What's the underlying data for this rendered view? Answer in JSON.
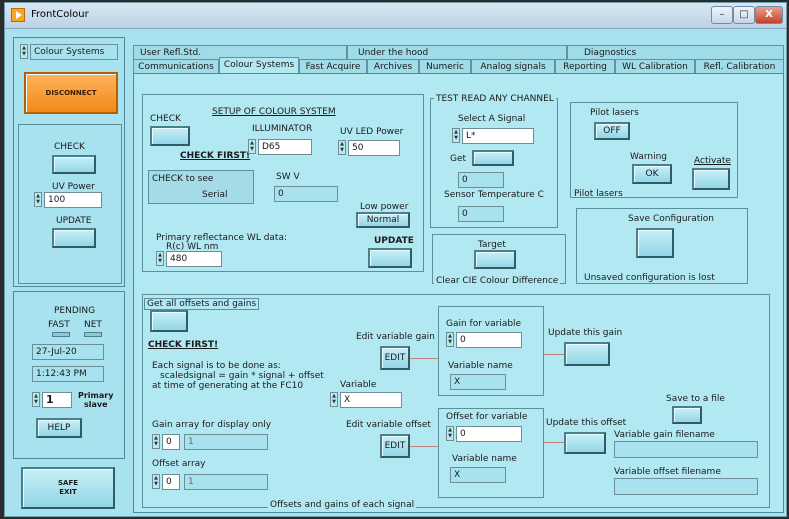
{
  "window": {
    "title": "FrontColour",
    "min": "–",
    "max": "□",
    "close": "X"
  },
  "left": {
    "nav_label": "Colour Systems",
    "disconnect": "DISCONNECT",
    "check": "CHECK",
    "uv_power_label": "UV Power",
    "uv_power_value": "100",
    "update": "UPDATE",
    "pending": "PENDING",
    "fast": "FAST",
    "net": "NET",
    "date": "27-Jul-20",
    "time": "1:12:43 PM",
    "slave_value": "1",
    "primary": "Primary",
    "slave": "slave",
    "help": "HELP",
    "safe_exit": "SAFE\nEXIT"
  },
  "tabs_row1": [
    "User Refl.Std.",
    "Under the hood",
    "Diagnostics"
  ],
  "tabs_row2": [
    "Communications",
    "Colour Systems",
    "Fast Acquire",
    "Archives",
    "Numeric",
    "Analog signals",
    "Reporting",
    "WL Calibration",
    "Refl. Calibration"
  ],
  "setup": {
    "check": "CHECK",
    "title": "SETUP OF COLOUR SYSTEM",
    "check_first": "CHECK FIRST!",
    "illuminator": "ILLUMINATOR",
    "illuminator_value": "D65",
    "uv_led_power": "UV LED Power",
    "uv_led_value": "50",
    "check_to_see": "CHECK to see",
    "serial": "Serial",
    "sw_v": "SW V",
    "sw_v_value": "0",
    "low_power": "Low power",
    "normal": "Normal",
    "primary_wl": "Primary reflectance WL data:",
    "rwl": "R(c) WL nm",
    "wl_value": "480",
    "update": "UPDATE"
  },
  "test": {
    "title": "TEST READ ANY CHANNEL",
    "select": "Select A Signal",
    "select_value": "L*",
    "get": "Get",
    "get_value": "0",
    "sensor_temp": "Sensor Temperature C",
    "temp_value": "0"
  },
  "target": {
    "label": "Target",
    "caption": "Clear CIE Colour Difference"
  },
  "pilot": {
    "title": "Pilot lasers",
    "off": "OFF",
    "warning": "Warning",
    "ok": "OK",
    "activate": "Activate",
    "footer": "Pilot lasers"
  },
  "save_config": {
    "title": "Save Configuration",
    "note": "Unsaved  configuration is lost"
  },
  "offsets": {
    "get_all": "Get all offsets and gains",
    "check_first": "CHECK FIRST!",
    "note1": "Each signal is to be done as:",
    "note2": "scaledsignal = gain * signal  + offset",
    "note3": "at time of  generating at the FC10",
    "variable": "Variable",
    "variable_value": "X",
    "gain_array": "Gain array for display only",
    "gain_idx": "0",
    "gain_val": "1",
    "offset_array": "Offset array",
    "offset_idx": "0",
    "offset_val": "1",
    "edit_gain": "Edit variable gain",
    "edit": "EDIT",
    "gain_for_var": "Gain for variable",
    "gain_value": "0",
    "var_name": "Variable name",
    "var_name_value": "X",
    "update_gain": "Update this gain",
    "edit_offset": "Edit variable offset",
    "offset_for_var": "Offset for variable",
    "offset_value": "0",
    "var_name2": "Variable name",
    "var_name2_value": "X",
    "update_offset": "Update this offset",
    "save_file": "Save to a file",
    "gain_filename": "Variable gain filename",
    "offset_filename": "Variable offset filename",
    "caption": "Offsets and gains of each signal"
  }
}
